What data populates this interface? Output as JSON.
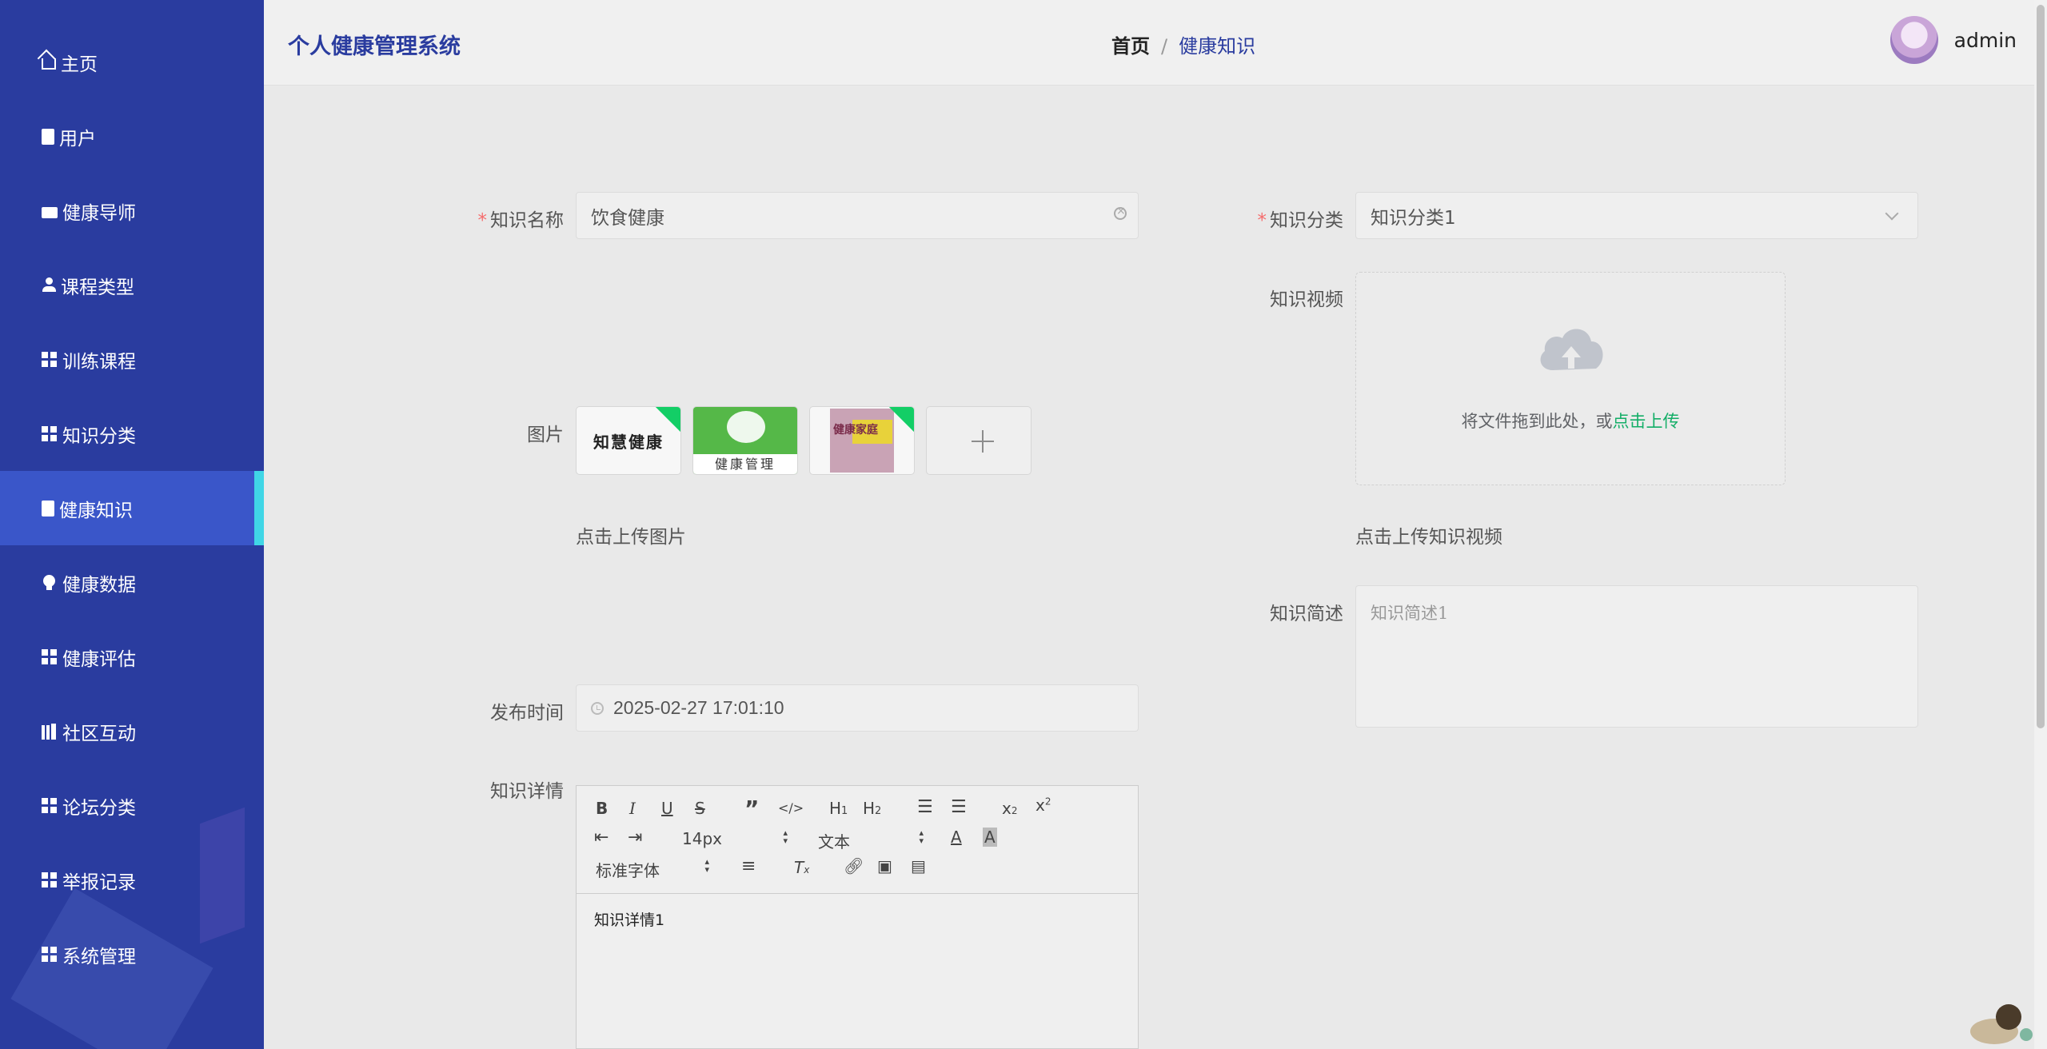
{
  "app": {
    "title": "个人健康管理系统"
  },
  "sidebar": {
    "items": [
      {
        "label": "主页",
        "icon": "home-icon"
      },
      {
        "label": "用户",
        "icon": "clipboard-icon"
      },
      {
        "label": "健康导师",
        "icon": "briefcase-icon"
      },
      {
        "label": "课程类型",
        "icon": "person-icon"
      },
      {
        "label": "训练课程",
        "icon": "grid-icon"
      },
      {
        "label": "知识分类",
        "icon": "grid-icon"
      },
      {
        "label": "健康知识",
        "icon": "clipboard-icon",
        "active": true
      },
      {
        "label": "健康数据",
        "icon": "bulb-icon"
      },
      {
        "label": "健康评估",
        "icon": "grid-icon"
      },
      {
        "label": "社区互动",
        "icon": "books-icon"
      },
      {
        "label": "论坛分类",
        "icon": "grid-icon"
      },
      {
        "label": "举报记录",
        "icon": "grid-icon"
      },
      {
        "label": "系统管理",
        "icon": "grid9-icon"
      }
    ]
  },
  "header": {
    "breadcrumb_home": "首页",
    "breadcrumb_sep": "/",
    "breadcrumb_current": "健康知识",
    "username": "admin"
  },
  "form": {
    "name": {
      "label": "知识名称",
      "value": "饮食健康"
    },
    "category": {
      "label": "知识分类",
      "value": "知识分类1"
    },
    "video": {
      "label": "知识视频",
      "upload_text": "将文件拖到此处，或",
      "upload_link": "点击上传",
      "hint": "点击上传知识视频"
    },
    "images": {
      "label": "图片",
      "hint": "点击上传图片",
      "thumb1_text": "知慧健康",
      "thumb2_caption": "健康管理",
      "thumb3_text": "健康家庭"
    },
    "summary": {
      "label": "知识简述",
      "value": "知识简述1"
    },
    "publish_time": {
      "label": "发布时间",
      "value": "2025-02-27 17:01:10"
    },
    "detail": {
      "label": "知识详情",
      "font_size": "14px",
      "block_format": "文本",
      "font_family": "标准字体",
      "content": "知识详情1"
    }
  },
  "colors": {
    "sidebar_bg": "#2a3c9f",
    "sidebar_active": "#3a56c9",
    "active_indicator": "#40d6e6",
    "required": "#f56c6c",
    "link_green": "#13ae67"
  }
}
